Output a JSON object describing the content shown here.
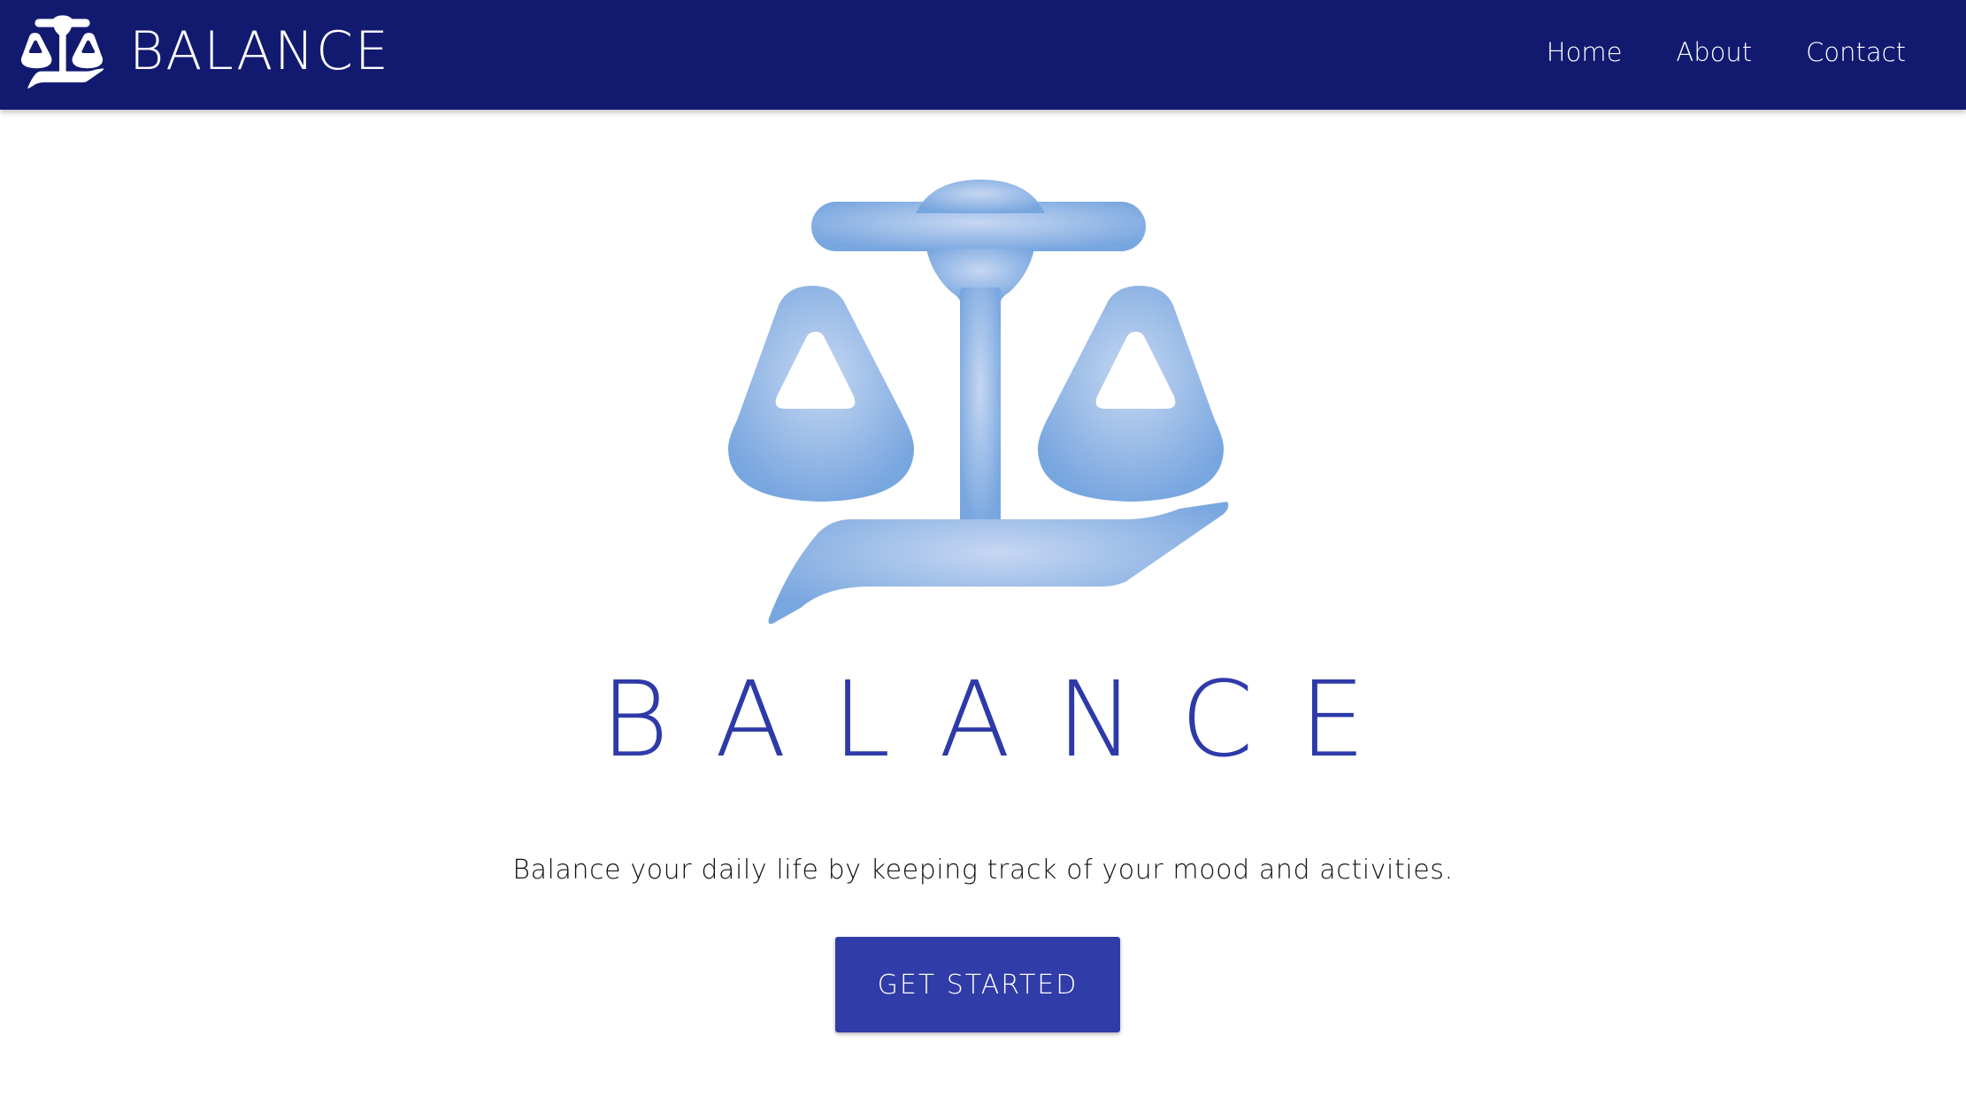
{
  "navbar": {
    "brand_icon": "balance-scale-icon",
    "brand_text": "BALANCE",
    "links": [
      {
        "label": "Home"
      },
      {
        "label": "About"
      },
      {
        "label": "Contact"
      }
    ]
  },
  "hero": {
    "logo_icon": "balance-scale-icon",
    "title": "BALANCE",
    "tagline": "Balance your daily life by keeping track of your mood and activities.",
    "cta_label": "GET STARTED"
  },
  "colors": {
    "navbar_bg": "#121a70",
    "accent": "#303ca8",
    "title": "#2e3aa8",
    "logo_gradient_center": "#c4d6f2",
    "logo_gradient_edge": "#7aa8e0"
  }
}
